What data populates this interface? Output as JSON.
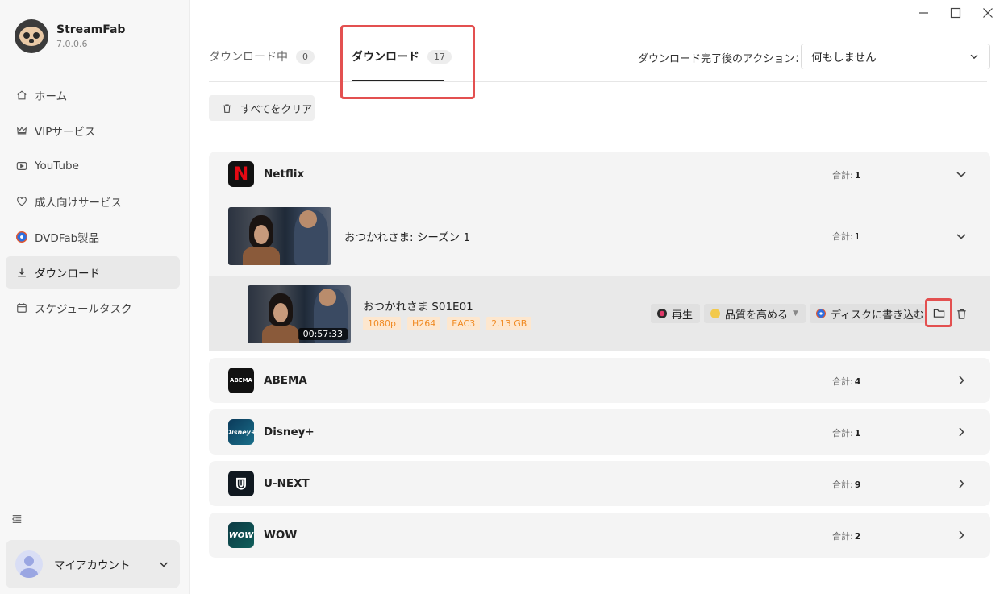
{
  "app": {
    "name": "StreamFab",
    "version": "7.0.0.6"
  },
  "sidebar": {
    "items": [
      {
        "label": "ホーム",
        "icon": "home-icon"
      },
      {
        "label": "VIPサービス",
        "icon": "crown-icon"
      },
      {
        "label": "YouTube",
        "icon": "play-icon"
      },
      {
        "label": "成人向けサービス",
        "icon": "heart-icon"
      },
      {
        "label": "DVDFab製品",
        "icon": "dvdfab-icon"
      },
      {
        "label": "ダウンロード",
        "icon": "download-icon",
        "active": true
      },
      {
        "label": "スケジュールタスク",
        "icon": "calendar-icon"
      }
    ],
    "account_label": "マイアカウント"
  },
  "tabs": [
    {
      "label": "ダウンロード中",
      "count": "0"
    },
    {
      "label": "ダウンロード",
      "count": "17",
      "active": true
    }
  ],
  "after_action": {
    "label": "ダウンロード完了後のアクション：",
    "value": "何もしません"
  },
  "clear_all_label": "すべてをクリア",
  "total_label": "合計:",
  "groups": [
    {
      "name": "Netflix",
      "count": "1",
      "expanded": true
    },
    {
      "name": "ABEMA",
      "count": "4",
      "logo_text": "ABEMA"
    },
    {
      "name": "Disney+",
      "count": "1",
      "logo_text": "Disney+"
    },
    {
      "name": "U-NEXT",
      "count": "9"
    },
    {
      "name": "WOW",
      "count": "2",
      "logo_text": "WOW"
    }
  ],
  "netflix_logo_text": "N",
  "season": {
    "title": "おつかれさま: シーズン 1",
    "count": "1"
  },
  "episode": {
    "title": "おつかれさま S01E01",
    "duration": "00:57:33",
    "tags": [
      "1080p",
      "H264",
      "EAC3",
      "2.13 GB"
    ],
    "actions": {
      "play": "再生",
      "quality": "品質を高める",
      "burn": "ディスクに書き込む"
    }
  },
  "colors": {
    "highlight": "#e35050",
    "tag_text": "#f08b24",
    "tag_bg": "#fde7cf",
    "netflix": "#e50914"
  }
}
